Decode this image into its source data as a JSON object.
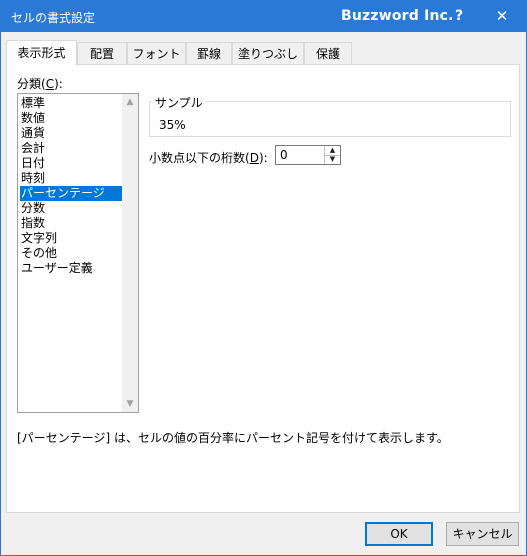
{
  "window": {
    "title": "セルの書式設定",
    "company": "Buzzword Inc.",
    "help": "?",
    "close": "✕"
  },
  "tabs": [
    "表示形式",
    "配置",
    "フォント",
    "罫線",
    "塗りつぶし",
    "保護"
  ],
  "category": {
    "label_prefix": "分類(",
    "label_key": "C",
    "label_suffix": "):",
    "items": [
      "標準",
      "数値",
      "通貨",
      "会計",
      "日付",
      "時刻",
      "パーセンテージ",
      "分数",
      "指数",
      "文字列",
      "その他",
      "ユーザー定義"
    ],
    "selected_index": 6
  },
  "sample": {
    "title": "サンプル",
    "value": "35%"
  },
  "decimal": {
    "label_prefix": "小数点以下の桁数(",
    "label_key": "D",
    "label_suffix": "):",
    "value": "0"
  },
  "description": "[パーセンテージ] は、セルの値の百分率にパーセント記号を付けて表示します。",
  "buttons": {
    "ok": "OK",
    "cancel": "キャンセル"
  },
  "colors": {
    "accent": "#2b79d7",
    "selection": "#0078d7"
  }
}
